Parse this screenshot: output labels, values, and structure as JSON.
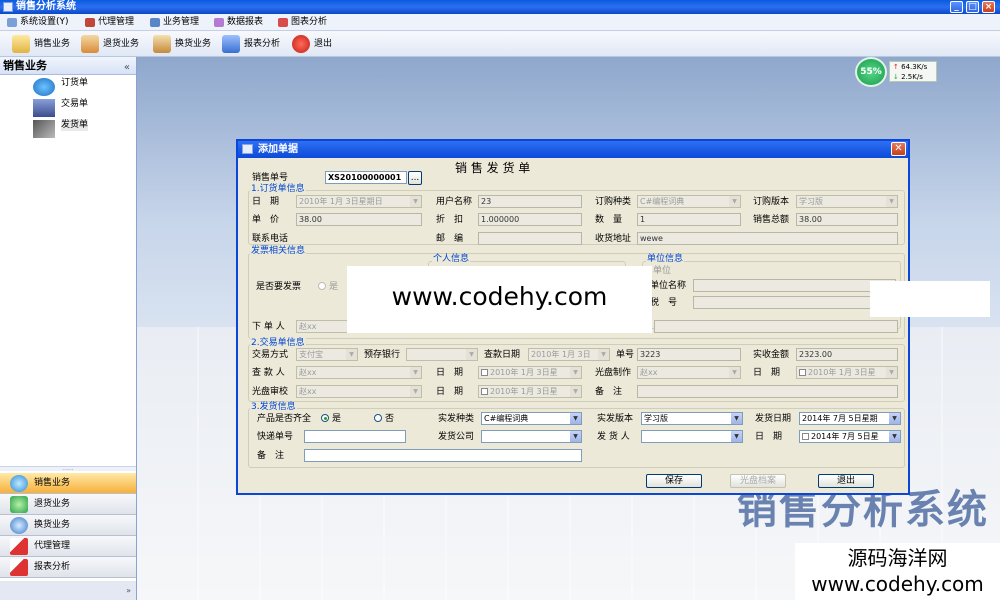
{
  "window": {
    "title": "销售分析系统"
  },
  "menu": [
    "系统设置(Y)",
    "代理管理",
    "业务管理",
    "数据报表",
    "图表分析"
  ],
  "toolbar": [
    "销售业务",
    "退货业务",
    "换货业务",
    "报表分析",
    "退出"
  ],
  "left_panel": {
    "title": "销售业务",
    "collapse": "«",
    "tree": [
      "订货单",
      "交易单",
      "发货单"
    ],
    "splitter": "......",
    "nav": [
      "销售业务",
      "退货业务",
      "换货业务",
      "代理管理",
      "报表分析"
    ],
    "bottom_glyph": "»"
  },
  "network": {
    "percent": "55%",
    "up": "64.3K/s",
    "down": "2.5K/s",
    "up_arrow": "↑",
    "down_arrow": "↓"
  },
  "background_title": "销售分析系统",
  "dialog": {
    "title": "添加单据",
    "close": "✕",
    "heading": "销 售 发 货 单",
    "order_no_label": "销售单号",
    "order_no": "XS20100000001",
    "lookup": "...",
    "sec1": {
      "title": "1.订货单信息",
      "date_label": "日　期",
      "date": "2010年 1月 3日星期日",
      "username_label": "用户名称",
      "username": "23",
      "order_type_label": "订购种类",
      "order_type": "C#编程词典",
      "order_version_label": "订购版本",
      "order_version": "学习版",
      "price_label": "单　价",
      "price": "38.00",
      "discount_label": "折　扣",
      "discount": "1.000000",
      "quantity_label": "数　量",
      "quantity": "1",
      "total_label": "销售总额",
      "total": "38.00",
      "phone_label": "联系电话",
      "zipcode_label": "邮　编",
      "address_label": "收货地址",
      "address": "wewe"
    },
    "invoice": {
      "title": "发票相关信息",
      "personal_title": "个人信息",
      "company_title": "单位信息",
      "need_invoice_label": "是否要发票",
      "yes": "是",
      "company_check": "单位",
      "company_name_label": "单位名称",
      "tax_label": "税　号",
      "orderer_label": "下 单 人",
      "orderer": "赵xx"
    },
    "sec2": {
      "title": "2.交易单信息",
      "trade_mode_label": "交易方式",
      "trade_mode": "支付宝",
      "bank_label": "预存银行",
      "check_date_label": "查款日期",
      "check_date": "2010年 1月 3日",
      "single_no_label": "单号",
      "single_no": "3223",
      "received_label": "实收金额",
      "received": "2323.00",
      "checker_label": "查 款 人",
      "checker": "赵xx",
      "date_label": "日　期",
      "date": "2010年 1月 3日星",
      "disc_make_label": "光盘制作",
      "disc_make": "赵xx",
      "date2_label": "日　期",
      "date2": "2010年 1月 3日星",
      "disc_audit_label": "光盘审校",
      "disc_audit": "赵xx",
      "date3_label": "日　期",
      "date3": "2010年 1月 3日星",
      "remark_label": "备　注"
    },
    "sec3": {
      "title": "3.发货信息",
      "complete_label": "产品是否齐全",
      "yes": "是",
      "no": "否",
      "ship_type_label": "实发种类",
      "ship_type": "C#编程词典",
      "ship_version_label": "实发版本",
      "ship_version": "学习版",
      "ship_date_label": "发货日期",
      "ship_date": "2014年 7月 5日星期",
      "express_label": "快递单号",
      "company_label": "发货公司",
      "shipper_label": "发 货 人",
      "date_label": "日　期",
      "date": "2014年 7月 5日星",
      "remark_label": "备　注"
    },
    "buttons": {
      "save": "保存",
      "disc_archive": "光盘档案",
      "exit": "退出"
    }
  },
  "watermark": {
    "center": "www.codehy.com",
    "bottom_cn": "源码海洋网",
    "bottom_url": "www.codehy.com"
  }
}
